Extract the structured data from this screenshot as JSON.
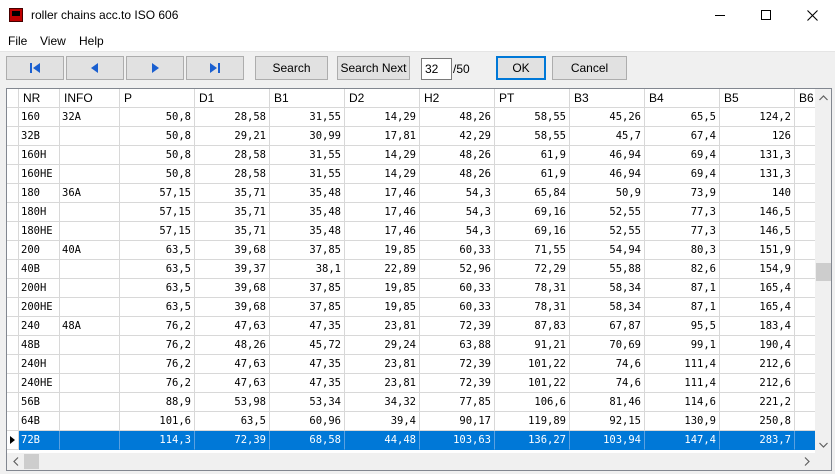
{
  "window": {
    "title": "roller chains acc.to ISO 606"
  },
  "menu": {
    "file": "File",
    "view": "View",
    "help": "Help"
  },
  "toolbar": {
    "search_label": "Search",
    "search_next_label": "Search Next",
    "page_value": "32",
    "page_total": "/50",
    "ok_label": "OK",
    "cancel_label": "Cancel"
  },
  "icons": {
    "first": "first-record-icon",
    "prev": "previous-record-icon",
    "next": "next-record-icon",
    "last": "last-record-icon"
  },
  "colors": {
    "accent": "#0078d7",
    "selection": "#0078d7"
  },
  "table": {
    "columns": [
      "NR",
      "INFO",
      "P",
      "D1",
      "B1",
      "D2",
      "H2",
      "PT",
      "B3",
      "B4",
      "B5",
      "B6"
    ],
    "rows": [
      [
        "160",
        "32A",
        "50,8",
        "28,58",
        "31,55",
        "14,29",
        "48,26",
        "58,55",
        "45,26",
        "65,5",
        "124,2"
      ],
      [
        "32B",
        "",
        "50,8",
        "29,21",
        "30,99",
        "17,81",
        "42,29",
        "58,55",
        "45,7",
        "67,4",
        "126"
      ],
      [
        "160H",
        "",
        "50,8",
        "28,58",
        "31,55",
        "14,29",
        "48,26",
        "61,9",
        "46,94",
        "69,4",
        "131,3"
      ],
      [
        "160HE",
        "",
        "50,8",
        "28,58",
        "31,55",
        "14,29",
        "48,26",
        "61,9",
        "46,94",
        "69,4",
        "131,3"
      ],
      [
        "180",
        "36A",
        "57,15",
        "35,71",
        "35,48",
        "17,46",
        "54,3",
        "65,84",
        "50,9",
        "73,9",
        "140"
      ],
      [
        "180H",
        "",
        "57,15",
        "35,71",
        "35,48",
        "17,46",
        "54,3",
        "69,16",
        "52,55",
        "77,3",
        "146,5"
      ],
      [
        "180HE",
        "",
        "57,15",
        "35,71",
        "35,48",
        "17,46",
        "54,3",
        "69,16",
        "52,55",
        "77,3",
        "146,5"
      ],
      [
        "200",
        "40A",
        "63,5",
        "39,68",
        "37,85",
        "19,85",
        "60,33",
        "71,55",
        "54,94",
        "80,3",
        "151,9"
      ],
      [
        "40B",
        "",
        "63,5",
        "39,37",
        "38,1",
        "22,89",
        "52,96",
        "72,29",
        "55,88",
        "82,6",
        "154,9"
      ],
      [
        "200H",
        "",
        "63,5",
        "39,68",
        "37,85",
        "19,85",
        "60,33",
        "78,31",
        "58,34",
        "87,1",
        "165,4"
      ],
      [
        "200HE",
        "",
        "63,5",
        "39,68",
        "37,85",
        "19,85",
        "60,33",
        "78,31",
        "58,34",
        "87,1",
        "165,4"
      ],
      [
        "240",
        "48A",
        "76,2",
        "47,63",
        "47,35",
        "23,81",
        "72,39",
        "87,83",
        "67,87",
        "95,5",
        "183,4"
      ],
      [
        "48B",
        "",
        "76,2",
        "48,26",
        "45,72",
        "29,24",
        "63,88",
        "91,21",
        "70,69",
        "99,1",
        "190,4"
      ],
      [
        "240H",
        "",
        "76,2",
        "47,63",
        "47,35",
        "23,81",
        "72,39",
        "101,22",
        "74,6",
        "111,4",
        "212,6"
      ],
      [
        "240HE",
        "",
        "76,2",
        "47,63",
        "47,35",
        "23,81",
        "72,39",
        "101,22",
        "74,6",
        "111,4",
        "212,6"
      ],
      [
        "56B",
        "",
        "88,9",
        "53,98",
        "53,34",
        "34,32",
        "77,85",
        "106,6",
        "81,46",
        "114,6",
        "221,2"
      ],
      [
        "64B",
        "",
        "101,6",
        "63,5",
        "60,96",
        "39,4",
        "90,17",
        "119,89",
        "92,15",
        "130,9",
        "250,8"
      ],
      [
        "72B",
        "",
        "114,3",
        "72,39",
        "68,58",
        "44,48",
        "103,63",
        "136,27",
        "103,94",
        "147,4",
        "283,7"
      ]
    ],
    "selected_row": 17
  }
}
